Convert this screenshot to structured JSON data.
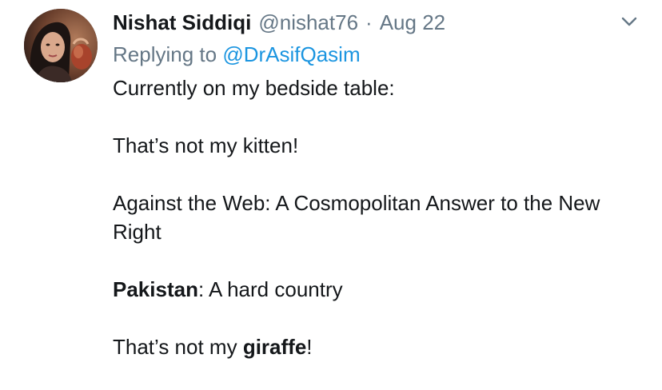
{
  "tweet": {
    "author_name": "Nishat Siddiqi",
    "author_handle": "@nishat76",
    "separator": "·",
    "date": "Aug 22",
    "replying_prefix": "Replying to",
    "replying_handle": "@DrAsifQasim",
    "intro": "Currently on my bedside table:",
    "book1": "That’s not my kitten!",
    "book2": "Against the Web: A Cosmopolitan Answer to the New Right",
    "book3_bold": "Pakistan",
    "book3_rest": ": A hard country",
    "book4_prefix": "That’s not my ",
    "book4_bold": "giraffe",
    "book4_suffix": "!"
  },
  "icons": {
    "caret": "chevron-down-icon",
    "avatar": "profile-photo"
  },
  "colors": {
    "text": "#14171a",
    "secondary": "#657786",
    "link": "#1b95e0"
  }
}
